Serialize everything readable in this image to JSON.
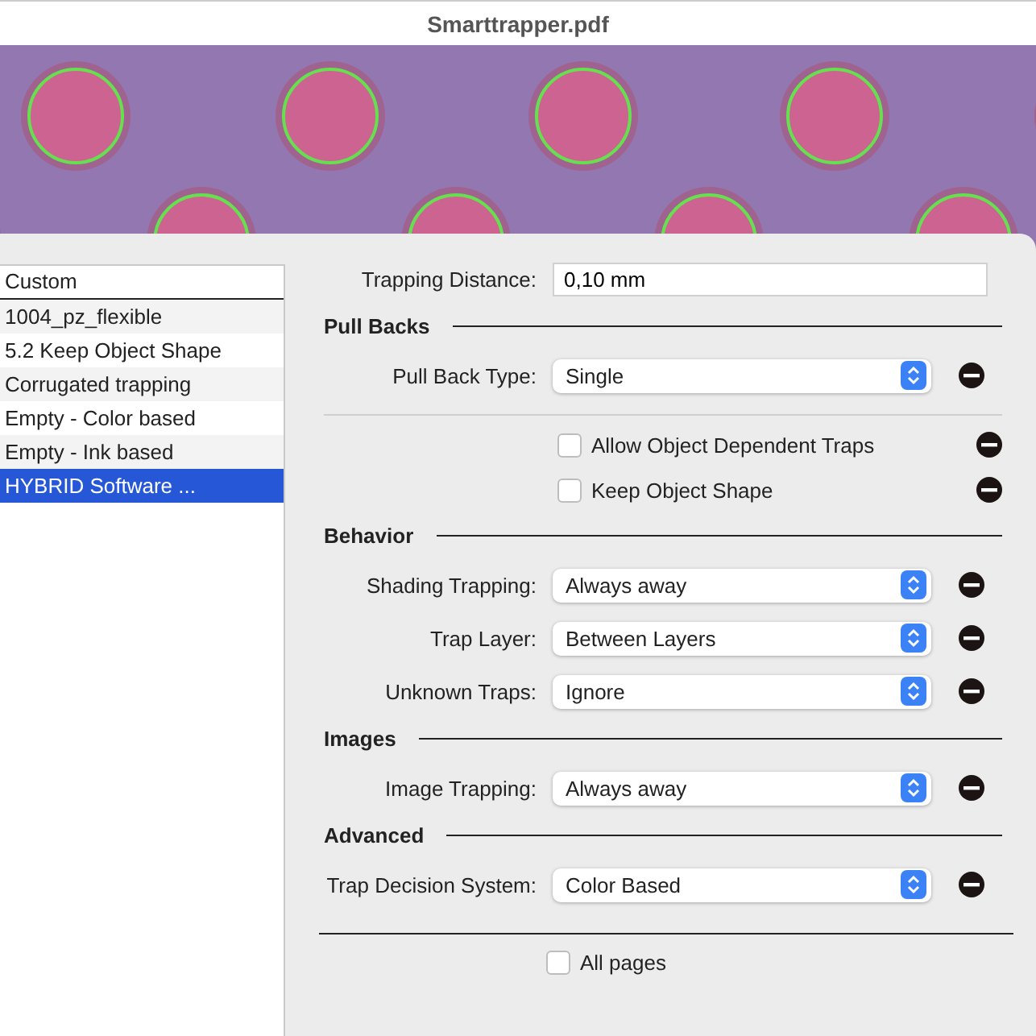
{
  "window": {
    "title": "Smarttrapper.pdf"
  },
  "preset_list": {
    "heading": "Custom",
    "items": [
      {
        "label": "1004_pz_flexible",
        "selected": false
      },
      {
        "label": "5.2 Keep Object Shape",
        "selected": false
      },
      {
        "label": "Corrugated trapping",
        "selected": false
      },
      {
        "label": "Empty - Color based",
        "selected": false
      },
      {
        "label": "Empty - Ink based",
        "selected": false
      },
      {
        "label": "HYBRID Software ...",
        "selected": true
      }
    ]
  },
  "trapping_distance": {
    "label": "Trapping Distance:",
    "value": "0,10 mm"
  },
  "sections": [
    {
      "title": "Pull Backs",
      "rows": [
        {
          "kind": "select",
          "label": "Pull Back Type:",
          "value": "Single"
        },
        {
          "kind": "divider"
        },
        {
          "kind": "checkbox",
          "label": "Allow Object Dependent Traps",
          "checked": false
        },
        {
          "kind": "checkbox",
          "label": "Keep Object Shape",
          "checked": false
        }
      ]
    },
    {
      "title": "Behavior",
      "rows": [
        {
          "kind": "select",
          "label": "Shading Trapping:",
          "value": "Always away"
        },
        {
          "kind": "select",
          "label": "Trap Layer:",
          "value": "Between Layers"
        },
        {
          "kind": "select",
          "label": "Unknown Traps:",
          "value": "Ignore"
        }
      ]
    },
    {
      "title": "Images",
      "rows": [
        {
          "kind": "select",
          "label": "Image Trapping:",
          "value": "Always away"
        }
      ]
    },
    {
      "title": "Advanced",
      "rows": [
        {
          "kind": "select",
          "label": "Trap Decision System:",
          "value": "Color Based"
        }
      ]
    }
  ],
  "all_pages": {
    "label": "All pages",
    "checked": false
  }
}
